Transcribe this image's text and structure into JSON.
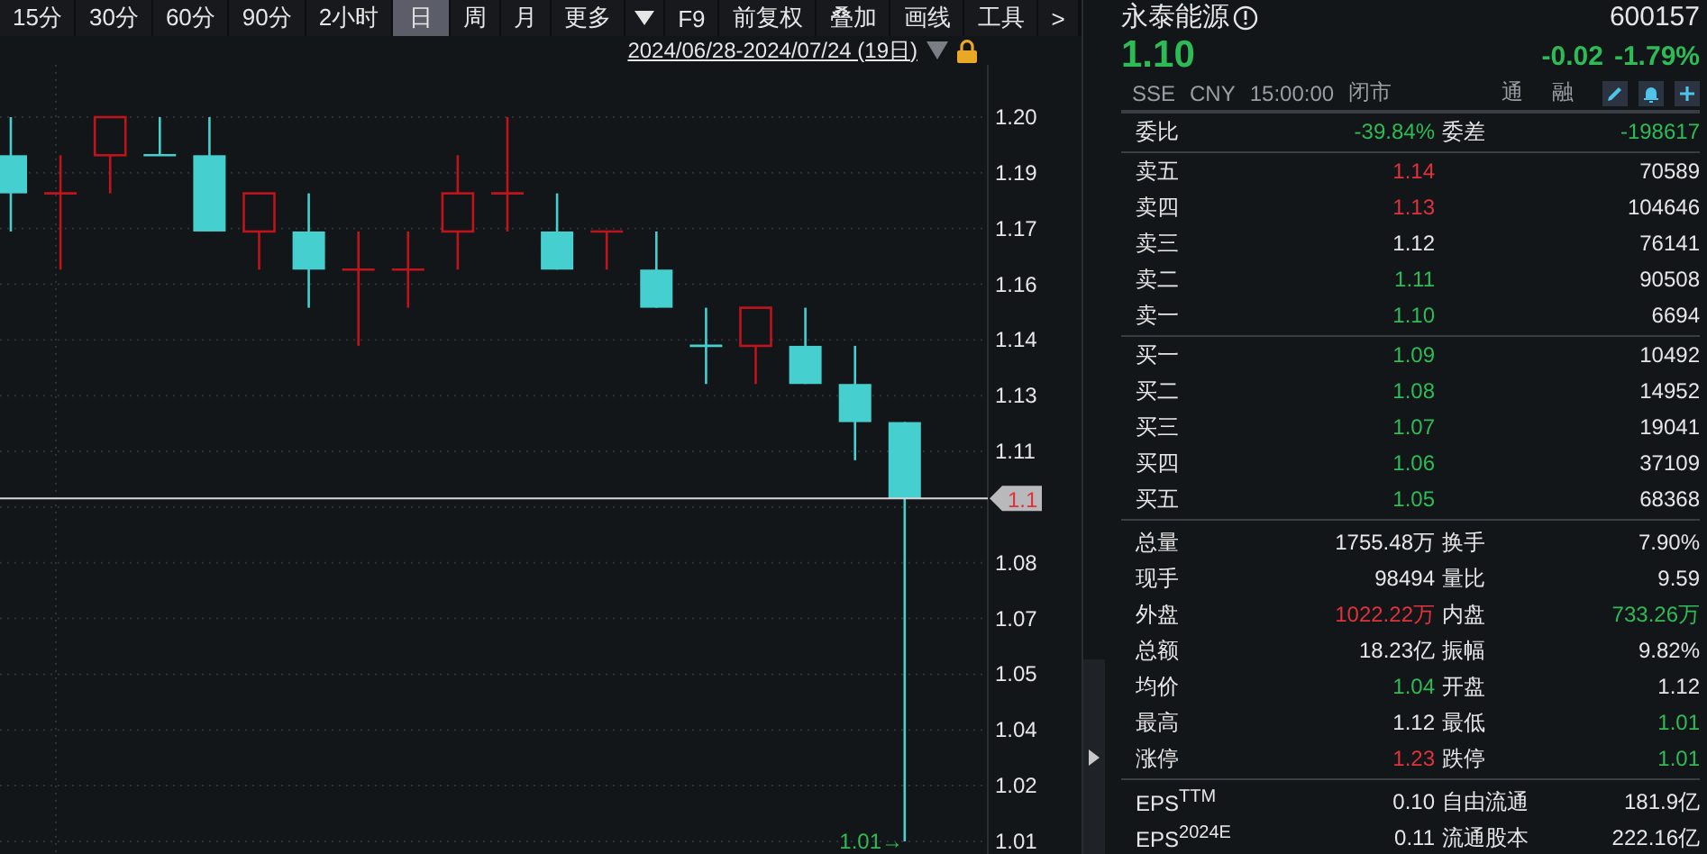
{
  "toolbar": {
    "periods": [
      {
        "label": "15分",
        "selected": false
      },
      {
        "label": "30分",
        "selected": false
      },
      {
        "label": "60分",
        "selected": false
      },
      {
        "label": "90分",
        "selected": false
      },
      {
        "label": "2小时",
        "selected": false
      },
      {
        "label": "日",
        "selected": true
      },
      {
        "label": "周",
        "selected": false
      },
      {
        "label": "月",
        "selected": false
      },
      {
        "label": "更多",
        "selected": false
      }
    ],
    "buttons": [
      "F9",
      "前复权",
      "叠加",
      "画线",
      "工具",
      ">"
    ]
  },
  "date_range": "2024/06/28-2024/07/24 (19日)",
  "price_axis": [
    "1.20",
    "1.19",
    "1.17",
    "1.16",
    "1.14",
    "1.13",
    "1.11",
    "1.08",
    "1.07",
    "1.05",
    "1.04",
    "1.02",
    "1.01"
  ],
  "last_price_tag": "1.1",
  "low_price_label": "1.01→",
  "quote": {
    "name": "永泰能源",
    "code": "600157",
    "price": "1.10",
    "change": "-0.02",
    "change_pct": "-1.79%",
    "color": "#2dbb56",
    "info": [
      "SSE",
      "CNY",
      "15:00:00",
      "闭市"
    ],
    "tags": [
      "通",
      "融"
    ]
  },
  "order_ratio": [
    {
      "label": "委比",
      "value": "-39.84%",
      "color": "#2dbb56"
    },
    {
      "label": "委差",
      "value": "-198617",
      "color": "#2dbb56"
    }
  ],
  "asks": [
    {
      "label": "卖五",
      "price": "1.14",
      "volume": "70589",
      "color": "#e0323c"
    },
    {
      "label": "卖四",
      "price": "1.13",
      "volume": "104646",
      "color": "#e0323c"
    },
    {
      "label": "卖三",
      "price": "1.12",
      "volume": "76141",
      "color": "#e6e6e6"
    },
    {
      "label": "卖二",
      "price": "1.11",
      "volume": "90508",
      "color": "#2dbb56"
    },
    {
      "label": "卖一",
      "price": "1.10",
      "volume": "6694",
      "color": "#2dbb56"
    }
  ],
  "bids": [
    {
      "label": "买一",
      "price": "1.09",
      "volume": "10492",
      "color": "#2dbb56"
    },
    {
      "label": "买二",
      "price": "1.08",
      "volume": "14952",
      "color": "#2dbb56"
    },
    {
      "label": "买三",
      "price": "1.07",
      "volume": "19041",
      "color": "#2dbb56"
    },
    {
      "label": "买四",
      "price": "1.06",
      "volume": "37109",
      "color": "#2dbb56"
    },
    {
      "label": "买五",
      "price": "1.05",
      "volume": "68368",
      "color": "#2dbb56"
    }
  ],
  "stats": [
    {
      "label": "总量",
      "value": "1755.48万",
      "color": "#e6e6e6"
    },
    {
      "label": "换手",
      "value": "7.90%",
      "color": "#e6e6e6"
    },
    {
      "label": "现手",
      "value": "98494",
      "color": "#e6e6e6"
    },
    {
      "label": "量比",
      "value": "9.59",
      "color": "#e6e6e6"
    },
    {
      "label": "外盘",
      "value": "1022.22万",
      "color": "#e0323c"
    },
    {
      "label": "内盘",
      "value": "733.26万",
      "color": "#2dbb56"
    },
    {
      "label": "总额",
      "value": "18.23亿",
      "color": "#e6e6e6"
    },
    {
      "label": "振幅",
      "value": "9.82%",
      "color": "#e6e6e6"
    },
    {
      "label": "均价",
      "value": "1.04",
      "color": "#2dbb56"
    },
    {
      "label": "开盘",
      "value": "1.12",
      "color": "#e6e6e6"
    },
    {
      "label": "最高",
      "value": "1.12",
      "color": "#e6e6e6"
    },
    {
      "label": "最低",
      "value": "1.01",
      "color": "#2dbb56"
    },
    {
      "label": "涨停",
      "value": "1.23",
      "color": "#e0323c"
    },
    {
      "label": "跌停",
      "value": "1.01",
      "color": "#2dbb56"
    }
  ],
  "fundamentals": [
    {
      "label": "EPS$^{TTM}$",
      "value": "0.10"
    },
    {
      "label": "自由流通",
      "value": "181.9亿"
    },
    {
      "label": "EPS$^{2024E}$",
      "value": "0.11"
    },
    {
      "label": "流通股本",
      "value": "222.16亿"
    }
  ]
}
